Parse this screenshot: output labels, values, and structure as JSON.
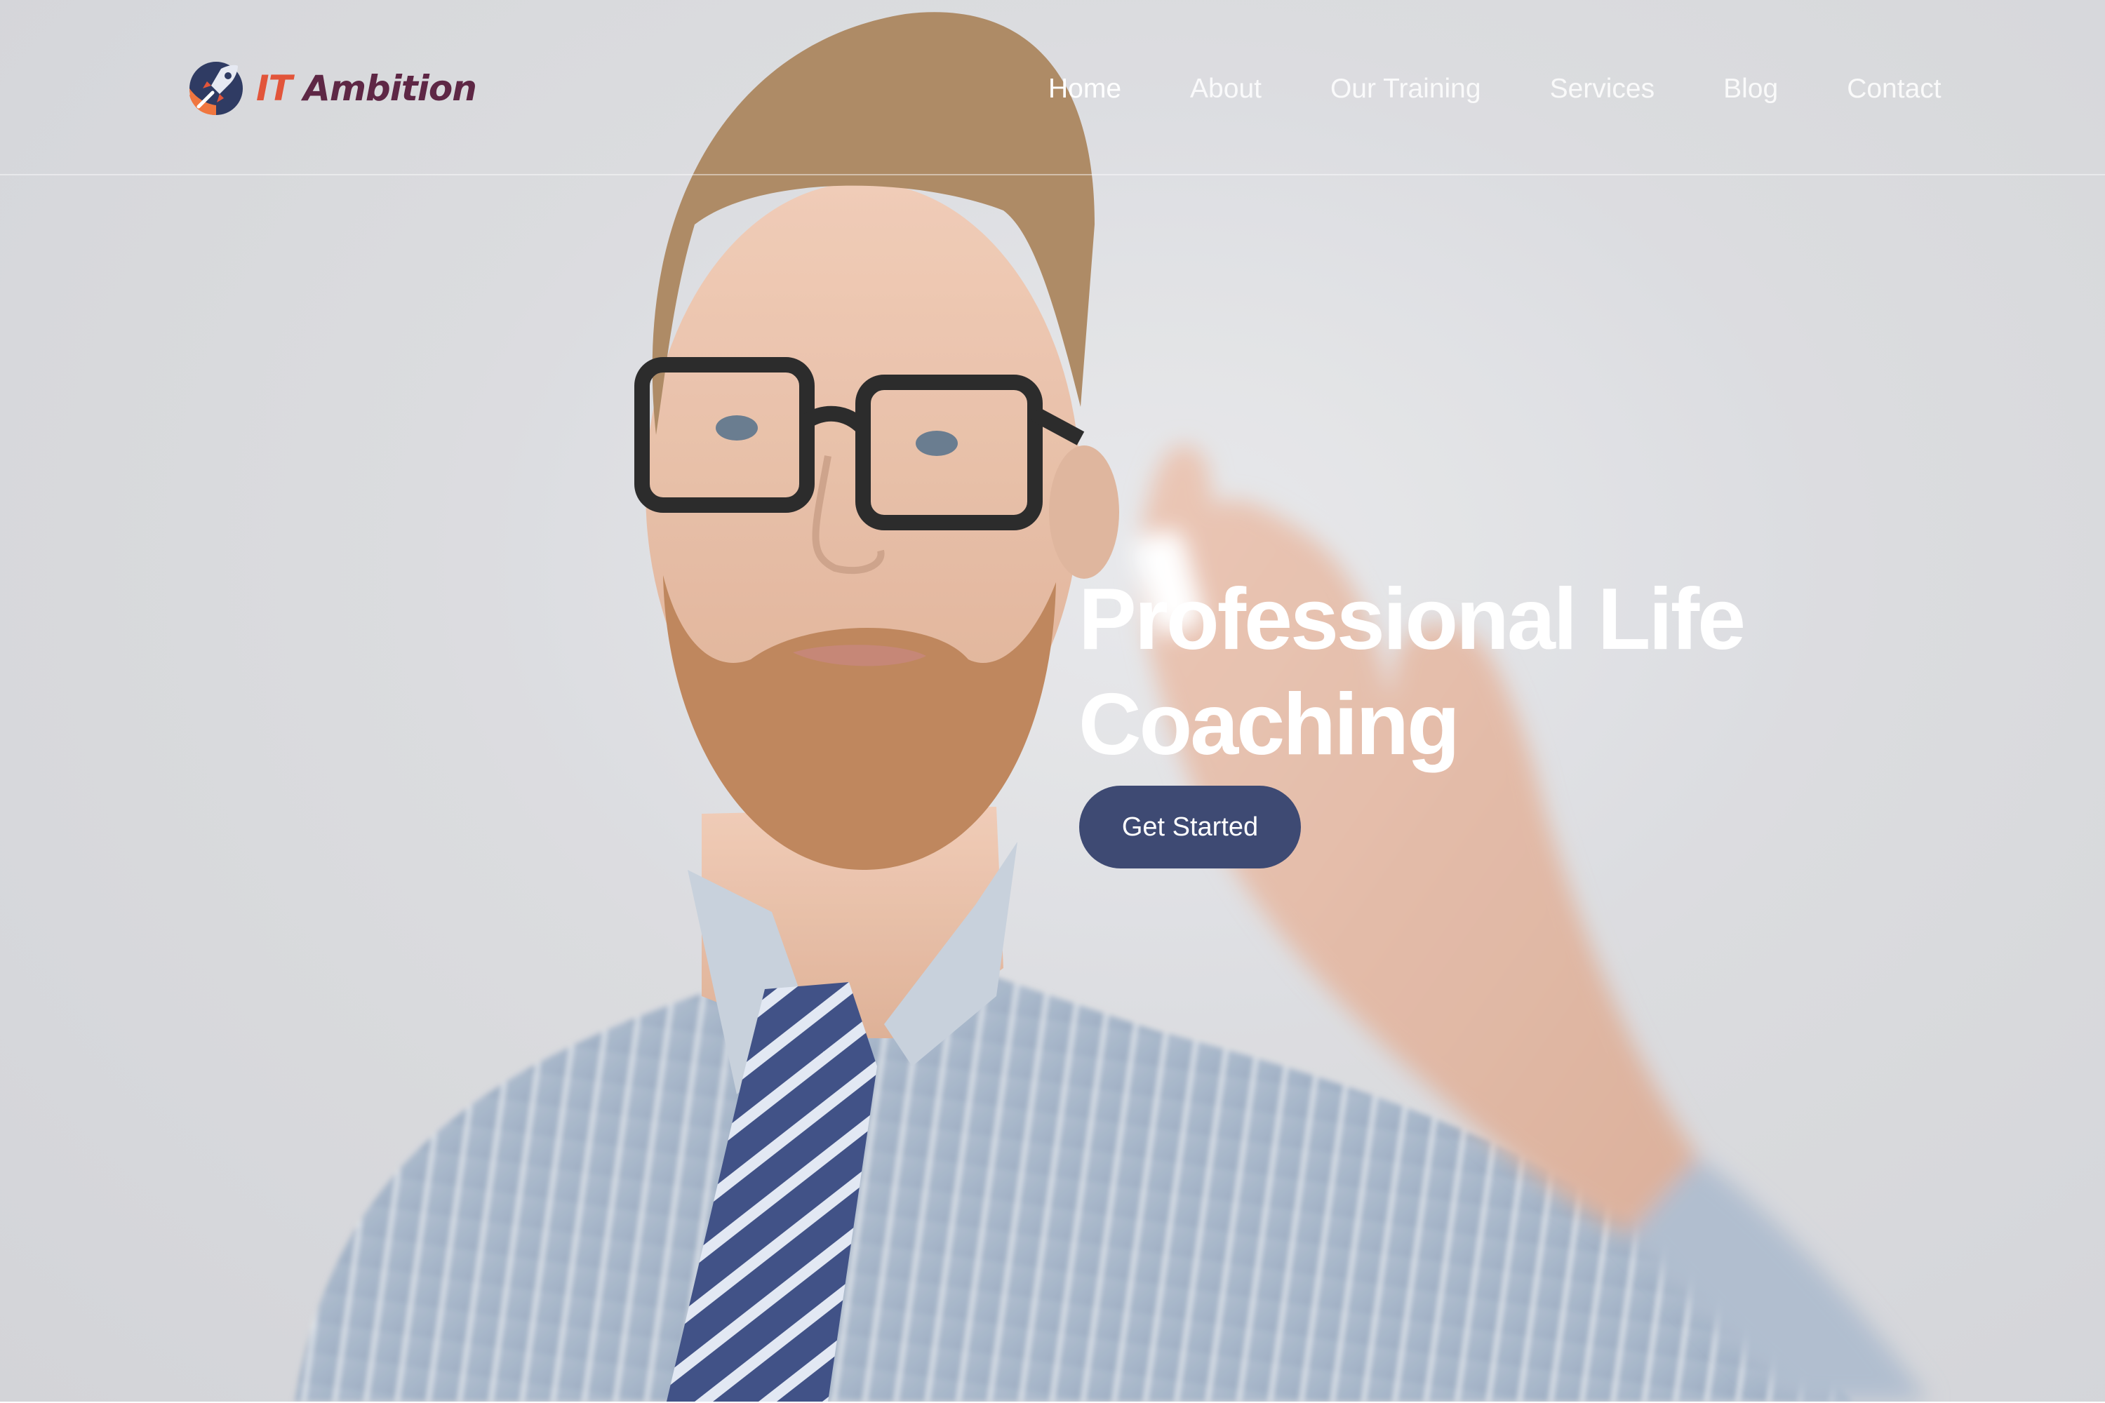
{
  "header": {
    "logo": {
      "text_prefix": "IT",
      "text_main": "Ambition",
      "icon": "rocket-globe-logo-icon"
    },
    "nav": [
      {
        "label": "Home",
        "active": true
      },
      {
        "label": "About",
        "active": false
      },
      {
        "label": "Our Training",
        "active": false
      },
      {
        "label": "Services",
        "active": false
      },
      {
        "label": "Blog",
        "active": false
      },
      {
        "label": "Contact",
        "active": false
      }
    ]
  },
  "hero": {
    "title_line1": "Professional Life",
    "title_line2": "Coaching",
    "cta_label": "Get Started",
    "image": "man-with-glasses-writing-on-glass"
  },
  "colors": {
    "cta_bg": "#3e4a73",
    "logo_it": "#e2553a",
    "logo_ambition": "#5e2745",
    "nav_text": "#ffffff"
  }
}
